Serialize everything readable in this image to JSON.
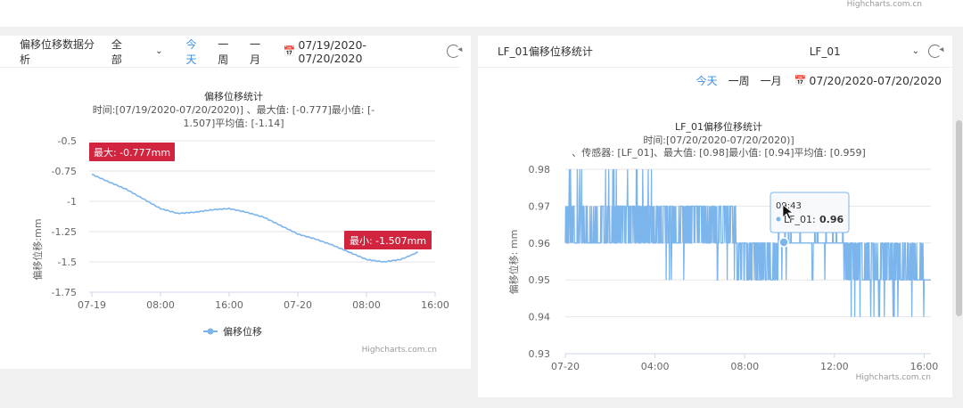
{
  "top_credit": "Highcharts.com.cn",
  "left_panel": {
    "title": "偏移位移数据分析",
    "filter_value": "全部",
    "ranges": [
      "今天",
      "一周",
      "一月"
    ],
    "active_range": "今天",
    "date_range": "07/19/2020-07/20/2020",
    "chart": {
      "title": "偏移位移统计",
      "subtitle_line1": "时间:[07/19/2020-07/20/2020)] 、最大值: [-0.777]最小值: [-",
      "subtitle_line2": "1.507]平均值: [-1.14]",
      "y_axis_title": "偏移位移:mm",
      "y_ticks": [
        "-0.5",
        "-0.75",
        "-1",
        "-1.25",
        "-1.5",
        "-1.75"
      ],
      "x_ticks": [
        "07-19",
        "08:00",
        "16:00",
        "07-20",
        "08:00",
        "16:00"
      ],
      "max_label": "最大: -0.777mm",
      "min_label": "最小: -1.507mm",
      "legend": "偏移位移",
      "credit": "Highcharts.com.cn"
    }
  },
  "right_panel": {
    "title": "LF_01偏移位移统计",
    "sensor_value": "LF_01",
    "ranges": [
      "今天",
      "一周",
      "一月"
    ],
    "active_range": "今天",
    "date_range": "07/20/2020-07/20/2020",
    "chart": {
      "title": "LF_01偏移位移统计",
      "subtitle_line1": "时间:[07/20/2020-07/20/2020)]",
      "subtitle_line2": "、传感器: [LF_01]、最大值: [0.98]最小值: [0.94]平均值: [0.959]",
      "y_axis_title": "偏移位移: mm",
      "y_ticks": [
        "0.98",
        "0.97",
        "0.96",
        "0.95",
        "0.94",
        "0.93"
      ],
      "x_ticks": [
        "07-20",
        "04:00",
        "08:00",
        "12:00",
        "16:00"
      ],
      "tooltip_time": "09:43",
      "tooltip_series": "LF_01:",
      "tooltip_value": "0.96",
      "credit": "Highcharts.com.cn"
    }
  },
  "colors": {
    "accent": "#3a8ee6",
    "series": "#7cb5ec",
    "flag": "#d0243f"
  },
  "chart_data": [
    {
      "type": "line",
      "title": "偏移位移统计",
      "ylabel": "偏移位移:mm",
      "ylim": [
        -1.75,
        -0.5
      ],
      "x_ticks": [
        "07-19",
        "08:00",
        "16:00",
        "07-20",
        "08:00",
        "16:00"
      ],
      "series": [
        {
          "name": "偏移位移",
          "x_hours": [
            0,
            2,
            4,
            6,
            8,
            10,
            12,
            14,
            16,
            18,
            20,
            22,
            24,
            26,
            28,
            30,
            32,
            34,
            36,
            38
          ],
          "values": [
            -0.777,
            -0.84,
            -0.9,
            -0.98,
            -1.06,
            -1.1,
            -1.09,
            -1.07,
            -1.06,
            -1.09,
            -1.13,
            -1.2,
            -1.27,
            -1.31,
            -1.36,
            -1.42,
            -1.48,
            -1.5,
            -1.48,
            -1.42
          ]
        }
      ],
      "annotations": [
        {
          "text": "最大: -0.777mm",
          "x_hour": 0,
          "value": -0.777
        },
        {
          "text": "最小: -1.507mm",
          "x_hour": 33,
          "value": -1.507
        }
      ]
    },
    {
      "type": "line",
      "title": "LF_01偏移位移统计",
      "ylabel": "偏移位移: mm",
      "ylim": [
        0.93,
        0.98
      ],
      "x_ticks": [
        "07-20",
        "04:00",
        "08:00",
        "12:00",
        "16:00"
      ],
      "series": [
        {
          "name": "LF_01",
          "description": "high-frequency readings oscillating between discrete levels",
          "x_hours": [
            0,
            1,
            2,
            3,
            4,
            5,
            6,
            7,
            8,
            9,
            10,
            11,
            12,
            13,
            14,
            15,
            16
          ],
          "values": [
            0.97,
            0.97,
            0.97,
            0.97,
            0.97,
            0.96,
            0.96,
            0.96,
            0.96,
            0.96,
            0.96,
            0.96,
            0.96,
            0.95,
            0.95,
            0.95,
            0.95
          ]
        }
      ],
      "tooltip": {
        "time": "09:43",
        "value": 0.96
      }
    }
  ]
}
